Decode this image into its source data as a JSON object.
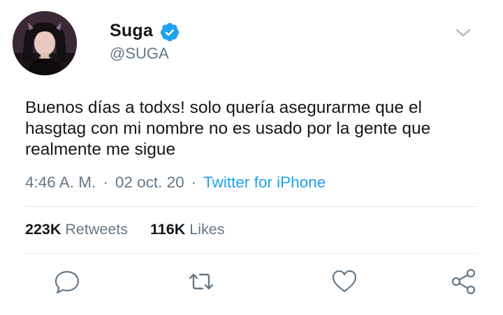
{
  "author": {
    "display_name": "Suga",
    "handle": "@SUGA",
    "verified": true,
    "verified_icon": "verified-badge-icon"
  },
  "tweet": {
    "text": "Buenos días a todxs! solo quería asegurarme que el hasgtag con mi nombre no es usado por la gente que realmente me sigue",
    "time": "4:46 A. M.",
    "date": "02 oct. 20",
    "separator": "·",
    "source": "Twitter for iPhone"
  },
  "stats": {
    "retweets_count": "223K",
    "retweets_label": "Retweets",
    "likes_count": "116K",
    "likes_label": "Likes"
  },
  "actions": [
    "reply-icon",
    "retweet-icon",
    "like-icon",
    "share-icon"
  ],
  "colors": {
    "text": "#14171a",
    "secondary": "#657786",
    "accent": "#1da1f2",
    "divider": "#e1e8ed"
  }
}
